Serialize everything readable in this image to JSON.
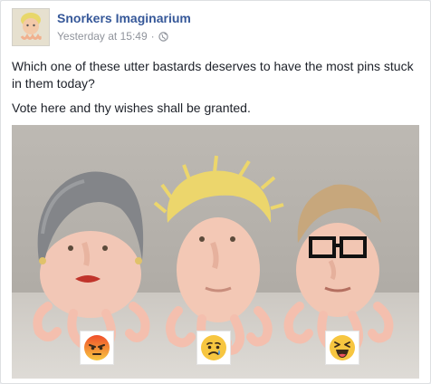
{
  "post": {
    "page_name": "Snorkers Imaginarium",
    "timestamp": "Yesterday at 15:49",
    "separator": "·",
    "privacy_icon": "globe-icon",
    "text_line1": "Which one of these utter bastards deserves to have the most pins stuck in them today?",
    "text_line2": "Vote here and thy wishes shall be granted."
  },
  "photo": {
    "reactions": [
      {
        "name": "angry-reaction",
        "color": "#f04e2a"
      },
      {
        "name": "sad-reaction",
        "color": "#f7c640"
      },
      {
        "name": "haha-reaction",
        "color": "#f7c640"
      }
    ]
  },
  "colors": {
    "link": "#365899",
    "meta": "#90949c",
    "text": "#1d2129",
    "border": "#dddfe2",
    "background": "#e9ebee"
  }
}
